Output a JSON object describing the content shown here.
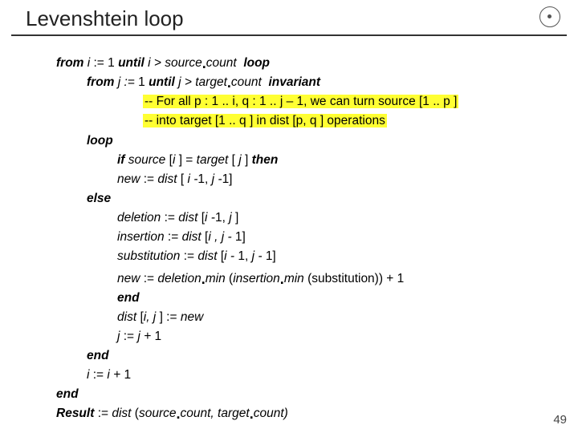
{
  "title": "Levenshtein loop",
  "lines": {
    "l1a": "from ",
    "l1b": "i ",
    "l1c": ":= 1 ",
    "l1d": "until ",
    "l1e": "i > source",
    "l1f": "count  ",
    "l1g": "loop",
    "l2a": "from ",
    "l2b": "j := ",
    "l2c": "1 ",
    "l2d": "until ",
    "l2e": "j > target",
    "l2f": "count ",
    "l2g": " invariant",
    "c1": "-- For all p : 1 .. i, q : 1 .. j – 1, we can turn source [1 .. p ]",
    "c2": "-- into target [1 .. q ] in dist [p, q ] operations",
    "l3": "loop",
    "l4a": "if ",
    "l4b": "source ",
    "l4c": "[",
    "l4d": "i ",
    "l4e": "] = ",
    "l4f": "target ",
    "l4g": "[ ",
    "l4h": "j ",
    "l4i": "] ",
    "l4j": "then",
    "l5a": "new ",
    "l5b": ":= ",
    "l5c": "dist ",
    "l5d": "[ ",
    "l5e": "i -",
    "l5f": "1, ",
    "l5g": "j -",
    "l5h": "1]",
    "l6": "else",
    "l7a": "deletion ",
    "l7b": ":= ",
    "l7c": "dist ",
    "l7d": "[",
    "l7e": "i -",
    "l7f": "1, ",
    "l7g": "j ",
    "l7h": "]",
    "l8a": "insertion ",
    "l8b": ":= ",
    "l8c": "dist ",
    "l8d": "[",
    "l8e": "i , j - ",
    "l8f": "1]",
    "l9a": "substitution ",
    "l9b": ":= ",
    "l9c": "dist ",
    "l9d": "[",
    "l9e": "i - ",
    "l9f": "1, ",
    "l9g": "j - ",
    "l9h": "1]",
    "l10a": "new ",
    "l10b": ":= ",
    "l10c": "deletion",
    "l10d": "min ",
    "l10e": "(",
    "l10f": "insertion",
    "l10g": "min ",
    "l10h": "(substitution)) + 1",
    "l11": "end",
    "l12a": "dist ",
    "l12b": "[",
    "l12c": "i, j ",
    "l12d": "] := ",
    "l12e": "new",
    "l13a": "j ",
    "l13b": ":= ",
    "l13c": "j + ",
    "l13d": "1",
    "l14": "end",
    "l15a": "i ",
    "l15b": ":= ",
    "l15c": "i + ",
    "l15d": "1",
    "l16": "end",
    "l17a": "Result ",
    "l17b": ":= ",
    "l17c": "dist ",
    "l17d": "(",
    "l17e": "source",
    "l17f": "count, ",
    "l17g": "target",
    "l17h": "count)"
  },
  "pageNumber": "49",
  "dot": "."
}
